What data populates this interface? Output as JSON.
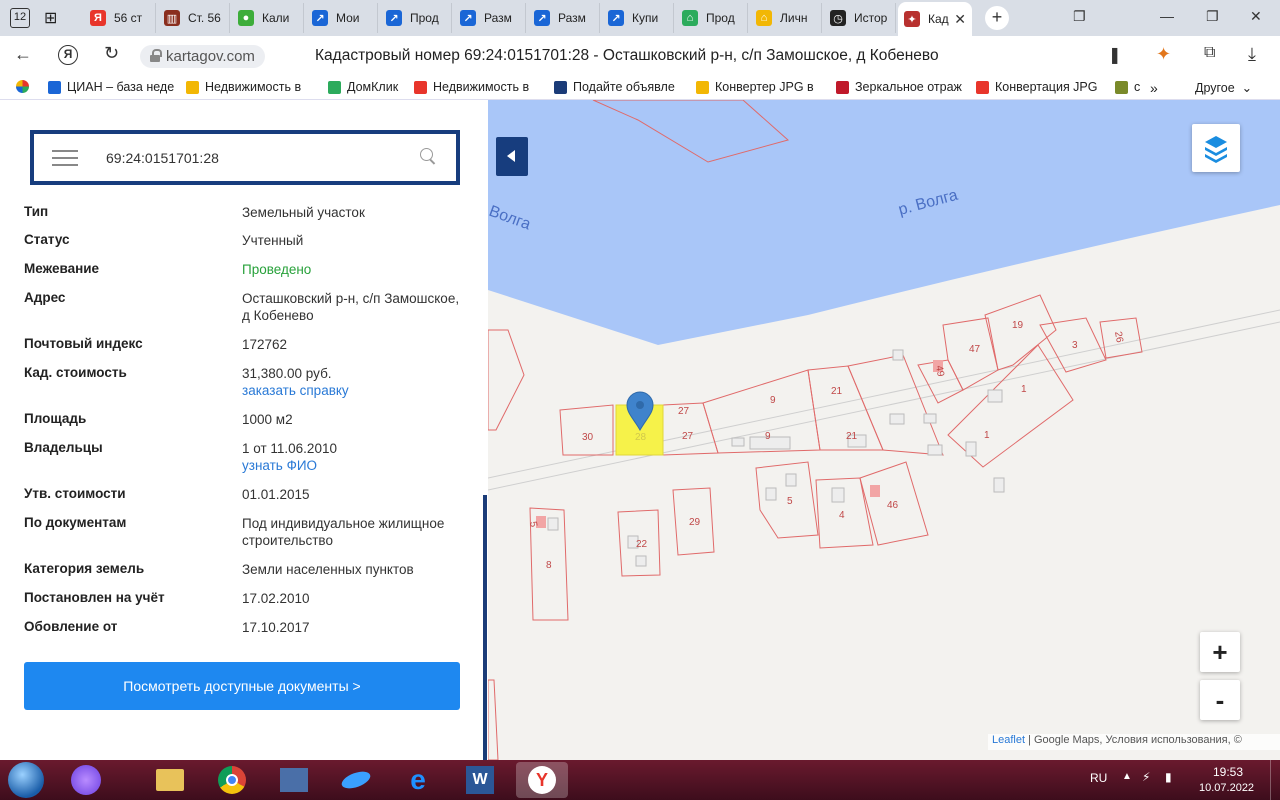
{
  "browser": {
    "tab_count_badge": "12",
    "tabs": [
      {
        "label": "56 ст",
        "color": "#e8352b",
        "glyph": "Я"
      },
      {
        "label": "Ст. 56",
        "color": "#8a2e1e",
        "glyph": "▥"
      },
      {
        "label": "Кали",
        "color": "#3dad3a",
        "glyph": "●"
      },
      {
        "label": "Мои",
        "color": "#1a66d6",
        "glyph": "↗"
      },
      {
        "label": "Прод",
        "color": "#1a66d6",
        "glyph": "↗"
      },
      {
        "label": "Разм",
        "color": "#1a66d6",
        "glyph": "↗"
      },
      {
        "label": "Разм",
        "color": "#1a66d6",
        "glyph": "↗"
      },
      {
        "label": "Купи",
        "color": "#1a66d6",
        "glyph": "↗"
      },
      {
        "label": "Прод",
        "color": "#2cab5c",
        "glyph": "⌂"
      },
      {
        "label": "Личн",
        "color": "#f2b705",
        "glyph": "⌂"
      },
      {
        "label": "Истор",
        "color": "#222",
        "glyph": "◷"
      },
      {
        "label": "Кад",
        "color": "#b8312f",
        "glyph": "✦"
      }
    ],
    "url": "kartagov.com",
    "page_title": "Кадастровый номер 69:24:0151701:28 - Осташковский р-н, с/п Замошское, д Кобенево",
    "bookmarks": [
      {
        "label": "ЦИАН – база неде",
        "color": "#1a66d6"
      },
      {
        "label": "Недвижимость в",
        "color": "#f2b705"
      },
      {
        "label": "ДомКлик",
        "color": "#2cab5c"
      },
      {
        "label": "Недвижимость в",
        "color": "#e8352b"
      },
      {
        "label": "Подайте объявле",
        "color": "#1b3c78"
      },
      {
        "label": "Конвертер JPG в",
        "color": "#f2b705"
      },
      {
        "label": "Зеркальное отраж",
        "color": "#c0192a"
      },
      {
        "label": "Конвертация JPG",
        "color": "#e8352b"
      },
      {
        "label": "с",
        "color": "#7a8a2a"
      }
    ],
    "other_bookmarks": "Другое"
  },
  "search": {
    "value": "69:24:0151701:28"
  },
  "details": [
    {
      "key": "Тип",
      "value": "Земельный участок"
    },
    {
      "key": "Статус",
      "value": "Учтенный"
    },
    {
      "key": "Межевание",
      "value": "Проведено"
    },
    {
      "key": "Адрес",
      "value": "Осташковский р-н, с/п Замошское, д Кобенево"
    },
    {
      "key": "Почтовый индекс",
      "value": "172762"
    },
    {
      "key": "Кад. стоимость",
      "value": "31,380.00 руб.",
      "link": "заказать справку"
    },
    {
      "key": "Площадь",
      "value": "1000 м2"
    },
    {
      "key": "Владельцы",
      "value": "1 от 11.06.2010",
      "link": "узнать ФИО"
    },
    {
      "key": "Утв. стоимости",
      "value": "01.01.2015"
    },
    {
      "key": "По документам",
      "value": "Под индивидуальное жилищное строительство"
    },
    {
      "key": "Категория земель",
      "value": "Земли населенных пунктов"
    },
    {
      "key": "Постановлен на учёт",
      "value": "17.02.2010"
    },
    {
      "key": "Обовление от",
      "value": "17.10.2017"
    }
  ],
  "docs_button": "Посмотреть доступные документы >",
  "map": {
    "river_label_1": "Волга",
    "river_label_2": "р. Волга",
    "parcel_labels": [
      "30",
      "28",
      "27",
      "27",
      "9",
      "9",
      "21",
      "21",
      "47",
      "19",
      "3",
      "26",
      "49",
      "1",
      "1",
      "5",
      "4",
      "46",
      "29",
      "22",
      "8",
      "5"
    ],
    "zoom_in": "+",
    "zoom_out": "-",
    "attribution_leaflet": "Leaflet",
    "attribution_rest": " | Google Maps, Условия использования, ©",
    "colors": {
      "river": "#a9c6f8",
      "parcel": "#e06a6a",
      "selected": "#f6f24a",
      "marker": "#3f83cc"
    }
  },
  "taskbar": {
    "lang": "RU",
    "time": "19:53",
    "date": "10.07.2022"
  }
}
